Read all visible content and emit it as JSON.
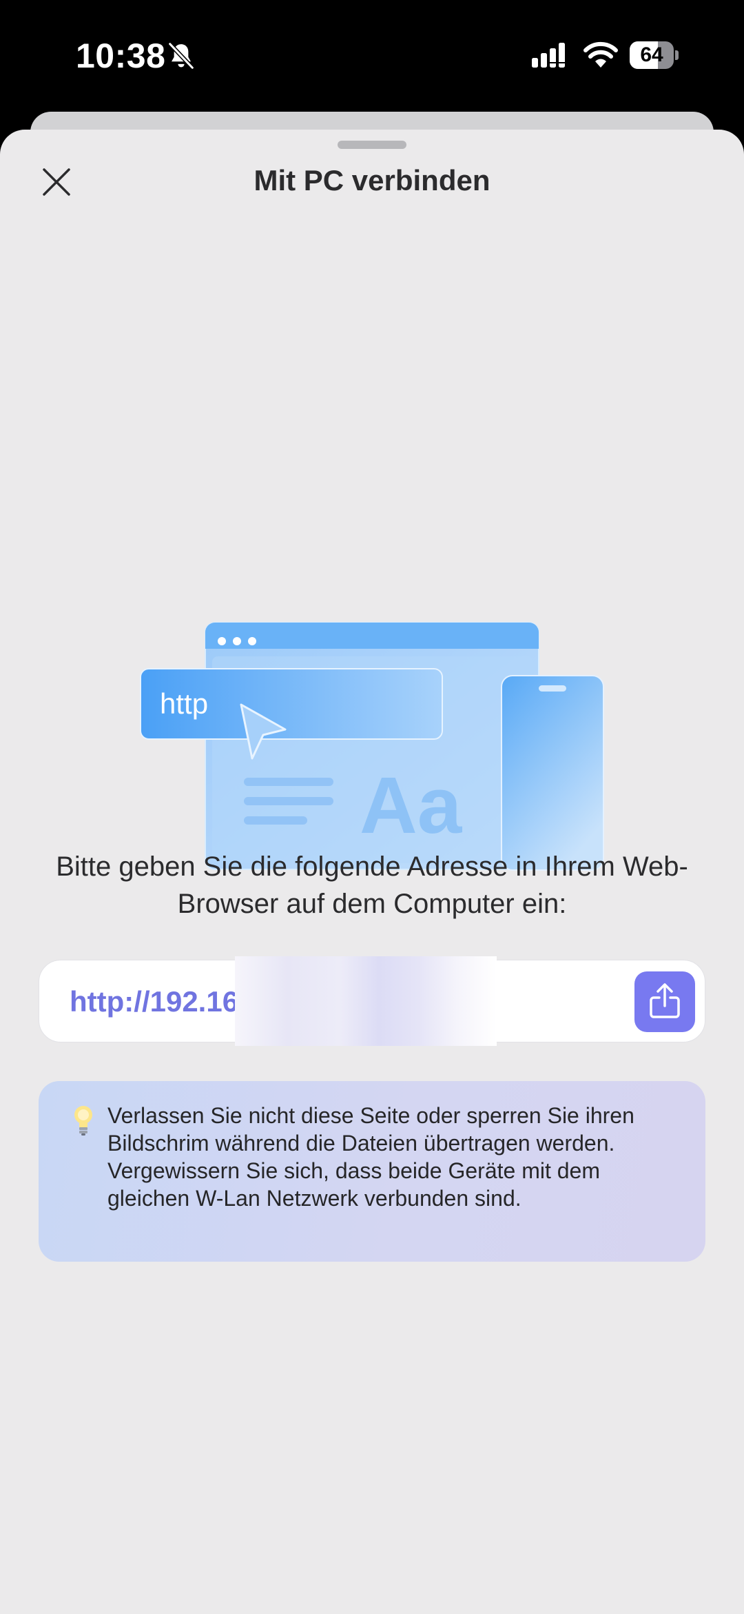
{
  "status_bar": {
    "time": "10:38",
    "battery_level": "64",
    "battery_fraction": 0.64
  },
  "sheet": {
    "title": "Mit PC verbinden",
    "close_icon": "close-icon"
  },
  "illustration": {
    "http_label": "http",
    "font_sample": "Aa"
  },
  "instruction": "Bitte geben Sie die folgende Adresse in Ihrem Web-Browser auf dem Computer ein:",
  "address": {
    "value": "http://192.16",
    "share_icon": "share-icon"
  },
  "tip": {
    "icon": "light-bulb-icon",
    "line1": "Verlassen Sie nicht diese Seite oder sperren Sie ihren Bildschrim während die Dateien übertragen werden.",
    "line2": "Vergewissern Sie sich, dass beide Geräte mit dem gleichen W-Lan Netzwerk verbunden sind."
  },
  "colors": {
    "accent": "#7879f0",
    "url_text": "#7074e0",
    "sheet_bg": "#ebeaeb"
  }
}
